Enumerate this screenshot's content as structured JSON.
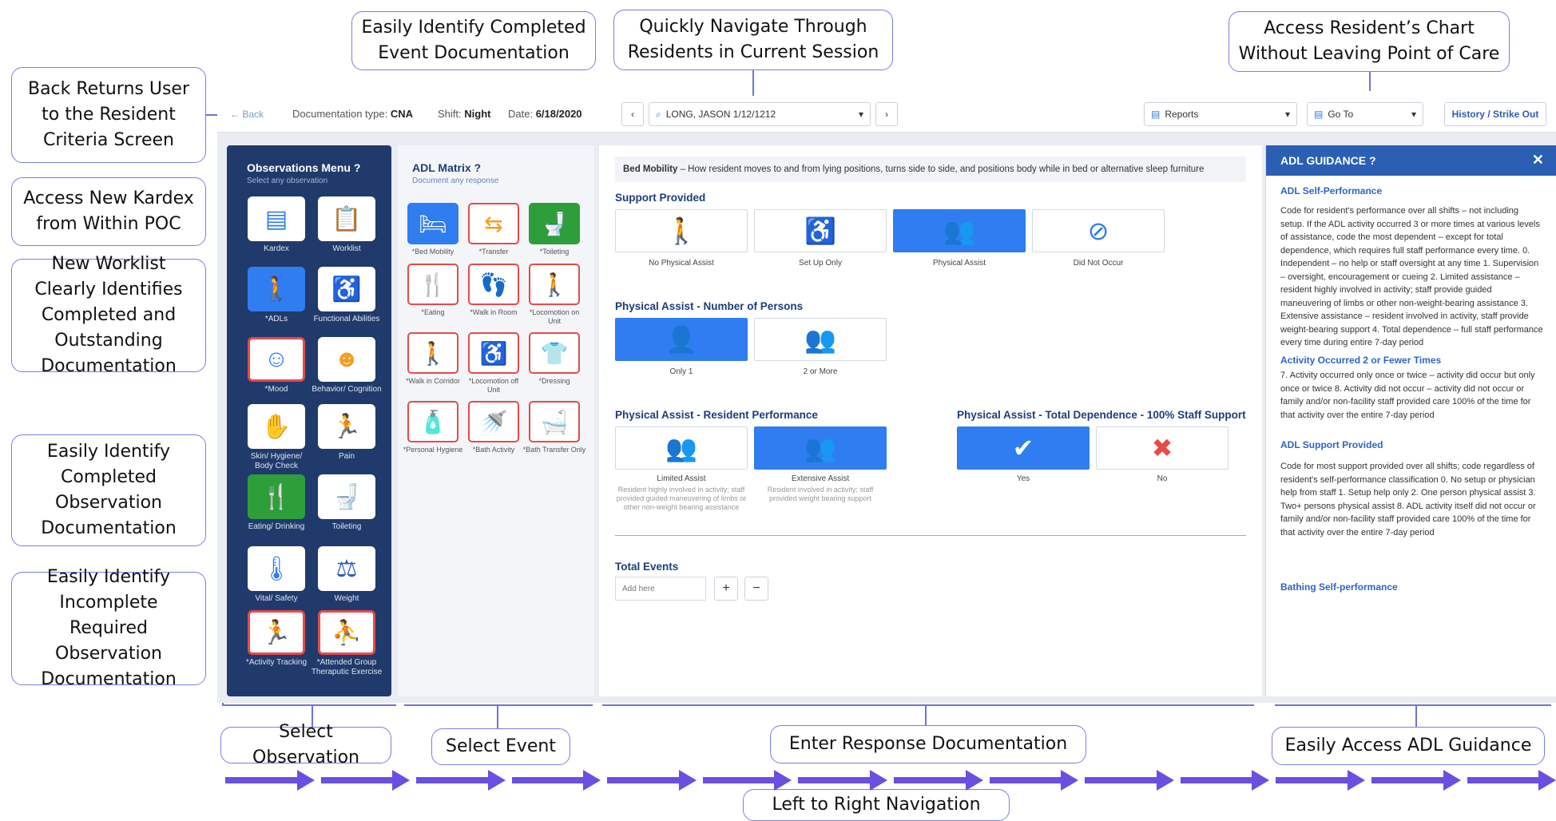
{
  "callouts": {
    "back": "Back Returns User to the Resident Criteria Screen",
    "completed_event": "Easily Identify Completed Event Documentation",
    "navigate": "Quickly Navigate Through Residents in Current Session",
    "chart": "Access Resident’s Chart Without Leaving Point of Care",
    "kardex": "Access New Kardex from Within POC",
    "worklist": "New Worklist Clearly Identifies Completed and Outstanding Documentation",
    "completed_obs": "Easily Identify Completed Observation Documentation",
    "incomplete": "Easily Identify Incomplete Required Observation Documentation",
    "select_obs": "Select Observation",
    "select_event": "Select Event",
    "enter_response": "Enter Response Documentation",
    "adl_guidance": "Easily Access ADL Guidance",
    "ltr": "Left to Right Navigation"
  },
  "topbar": {
    "back": "← Back",
    "doc_type_label": "Documentation type:",
    "doc_type": "CNA",
    "shift_label": "Shift:",
    "shift": "Night",
    "date_label": "Date:",
    "date": "6/18/2020",
    "resident": "LONG, JASON 1/12/1212",
    "reports": "Reports",
    "goto": "Go To",
    "history": "History / Strike Out"
  },
  "obs_menu": {
    "title": "Observations Menu",
    "subtitle": "Select any observation",
    "items": [
      "Kardex",
      "Worklist",
      "*ADLs",
      "Functional Abilities",
      "*Mood",
      "Behavior/ Cognition",
      "Skin/ Hygiene/ Body Check",
      "Pain",
      "Eating/ Drinking",
      "Toileting",
      "Vital/ Safety",
      "Weight",
      "*Activity Tracking",
      "*Attended Group Theraputic Exercise"
    ]
  },
  "adl_matrix": {
    "title": "ADL Matrix",
    "subtitle": "Document any response",
    "items": [
      "*Bed Mobility",
      "*Transfer",
      "*Toileting",
      "*Eating",
      "*Walk in Room",
      "*Locomotion on Unit",
      "*Walk in Corridor",
      "*Locomotion off Unit",
      "*Dressing",
      "*Personal Hygiene",
      "*Bath Activity",
      "*Bath Transfer Only"
    ]
  },
  "main": {
    "desc_bold": "Bed Mobility",
    "desc": " – How resident moves to and from lying positions, turns side to side, and positions body while in bed or alternative sleep furniture",
    "support_title": "Support Provided",
    "support": [
      "No Physical Assist",
      "Set Up Only",
      "Physical Assist",
      "Did Not Occur"
    ],
    "persons_title": "Physical Assist - Number of Persons",
    "persons": [
      "Only 1",
      "2 or More"
    ],
    "perf_title": "Physical Assist - Resident Performance",
    "perf": [
      "Limited Assist",
      "Extensive Assist"
    ],
    "perf_desc": [
      "Resident highly involved in activity; staff provided guided maneuvering of limbs or other non-weight bearing assistance",
      "Resident involved in activity; staff provided weight bearing support"
    ],
    "dep_title": "Physical Assist - Total Dependence - 100% Staff Support",
    "dep": [
      "Yes",
      "No"
    ],
    "total_title": "Total Events",
    "total_placeholder": "Add here"
  },
  "guidance": {
    "title": "ADL GUIDANCE",
    "self_title": "ADL Self-Performance",
    "self_text": "Code for resident's performance over all shifts – not including setup. If the ADL activity occurred 3 or more times at various levels of assistance, code the most dependent – except for total dependence, which requires full staff performance every time. 0. Independent – no help or staff oversight at any time 1. Supervision – oversight, encouragement or cueing 2. Limited assistance – resident highly involved in activity; staff provide guided maneuvering of limbs or other non-weight-bearing assistance 3. Extensive assistance – resident involved in activity, staff provide weight-bearing support 4. Total dependence – full staff performance every time during entire 7-day period",
    "occ_title": "Activity Occurred 2 or Fewer Times",
    "occ_text": "7. Activity occurred only once or twice – activity did occur but only once or twice 8. Activity did not occur – activity did not occur or family and/or non-facility staff provided care 100% of the time for that activity over the entire 7-day period",
    "support_title": "ADL Support Provided",
    "support_text": "Code for most support provided over all shifts; code regardless of resident's self-performance classification 0. No setup or physician help from staff 1. Setup help only 2. One person physical assist 3. Two+ persons physical assist 8. ADL activity itself did not occur or family and/or non-facility staff provided care 100% of the time for that activity over the entire 7-day period",
    "bathing_title": "Bathing Self-performance"
  },
  "colors": {
    "accent": "#6f73d6",
    "navy": "#203a6b",
    "blue": "#2f7df0",
    "red": "#e74a4a",
    "green": "#2e9e3b"
  }
}
